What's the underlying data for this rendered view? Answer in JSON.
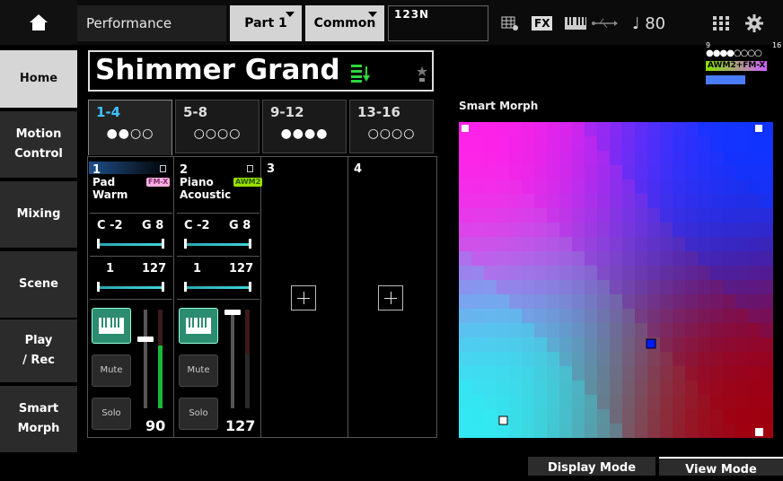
{
  "header": {
    "title": "Performance",
    "part_select": "Part 1",
    "common_select": "Common",
    "name_box": "123N",
    "tempo": "♩ 80"
  },
  "nav": {
    "items": [
      {
        "label": "Home",
        "active": true
      },
      {
        "label": "Motion\nControl"
      },
      {
        "label": "Mixing"
      },
      {
        "label": "Scene"
      },
      {
        "label": "Play\n/ Rec"
      },
      {
        "label": "Smart\nMorph"
      }
    ]
  },
  "performance": {
    "name": "Shimmer Grand",
    "voice_counter": {
      "min": "9",
      "max": "16"
    },
    "engine_badge": "AWM2+FM-X"
  },
  "tabs": [
    {
      "label": "1-4",
      "dots": "●●○○",
      "active": true
    },
    {
      "label": "5-8",
      "dots": "○○○○"
    },
    {
      "label": "9-12",
      "dots": "●●●●"
    },
    {
      "label": "13-16",
      "dots": "○○○○"
    }
  ],
  "parts": [
    {
      "number": "1",
      "name": "Pad\nWarm",
      "engine": "FM-X",
      "note_low": "C -2",
      "note_high": "G 8",
      "vel_low": "1",
      "vel_high": "127",
      "mute": "Mute",
      "solo": "Solo",
      "volume": "90",
      "level": 0.71
    },
    {
      "number": "2",
      "name": "Piano\nAcoustic",
      "engine": "AWM2",
      "note_low": "C -2",
      "note_high": "G 8",
      "vel_low": "1",
      "vel_high": "127",
      "mute": "Mute",
      "solo": "Solo",
      "volume": "127",
      "level": 1.0
    },
    {
      "number": "3"
    },
    {
      "number": "4"
    }
  ],
  "morph": {
    "title": "Smart Morph",
    "colors": {
      "top_left": "#ff22e8",
      "top_right": "#1133ff",
      "bottom_left": "#33e8f2",
      "bottom_right": "#a00010"
    }
  },
  "bottom": {
    "display_mode": "Display Mode",
    "view_mode": "View Mode"
  }
}
